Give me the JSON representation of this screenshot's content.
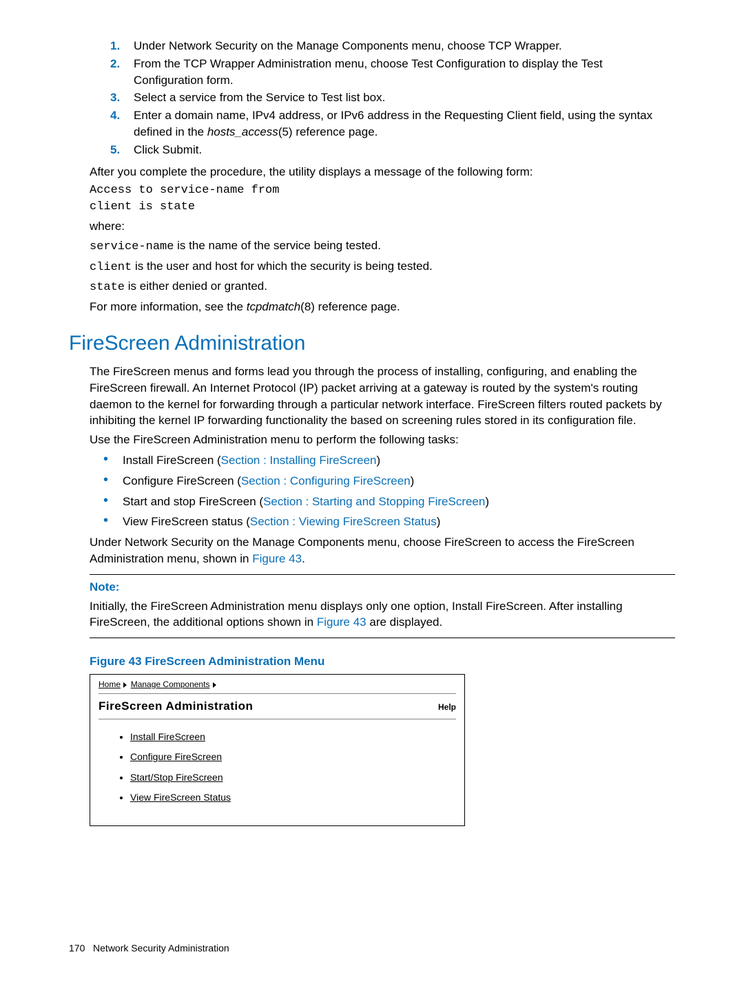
{
  "steps": [
    "Under Network Security on the Manage Components menu, choose TCP Wrapper.",
    "From the TCP Wrapper Administration menu, choose Test Configuration to display the Test Configuration form.",
    "Select a service from the Service to Test list box.",
    "Enter a domain name, IPv4 address, or IPv6 address in the Requesting Client field, using the syntax defined in the |hosts_access|(5) reference page.",
    "Click Submit."
  ],
  "after_proc": "After you complete the procedure, the utility displays a message of the following form:",
  "code_line1": "Access to service-name from",
  "code_line2": "client is state",
  "where_label": "where:",
  "where_l1a": "service-name",
  "where_l1b": " is the name of the service being tested.",
  "where_l2a": "client",
  "where_l2b": " is the user and host for which the security is being tested.",
  "where_l3a": "state",
  "where_l3b": " is either denied or granted.",
  "more_info_a": "For more information, see the ",
  "more_info_i": "tcpdmatch",
  "more_info_b": "(8) reference page.",
  "h2": "FireScreen Administration",
  "fs_para1": "The FireScreen menus and forms lead you through the process of installing, configuring, and enabling the FireScreen firewall. An Internet Protocol (IP) packet arriving at a gateway is routed by the system's routing daemon to the kernel for forwarding through a particular network interface. FireScreen filters routed packets by inhibiting the kernel IP forwarding functionality the based on screening rules stored in its configuration file.",
  "fs_para2": "Use the FireScreen Administration menu to perform the following tasks:",
  "bullets": [
    {
      "txt": "Install FireScreen (",
      "link": "Section : Installing FireScreen",
      "tail": ")"
    },
    {
      "txt": "Configure FireScreen (",
      "link": "Section : Configuring FireScreen",
      "tail": ")"
    },
    {
      "txt": "Start and stop FireScreen (",
      "link": "Section : Starting and Stopping FireScreen",
      "tail": ")"
    },
    {
      "txt": "View FireScreen status (",
      "link": "Section : Viewing FireScreen Status",
      "tail": ")"
    }
  ],
  "under_ns_a": "Under Network Security on the Manage Components menu, choose FireScreen to access the FireScreen Administration menu, shown in ",
  "under_ns_link": "Figure 43",
  "under_ns_b": ".",
  "note_label": "Note:",
  "note_body_a": "Initially, the FireScreen Administration menu displays only one option, Install FireScreen. After installing FireScreen, the additional options shown in ",
  "note_body_link": "Figure 43",
  "note_body_b": " are displayed.",
  "fig_caption": "Figure 43 FireScreen Administration Menu",
  "fig": {
    "bc_home": "Home",
    "bc_mc": "Manage Components",
    "title": "FireScreen Administration",
    "help": "Help",
    "items": [
      "Install FireScreen",
      "Configure FireScreen",
      "Start/Stop FireScreen",
      "View FireScreen Status"
    ]
  },
  "footer_page": "170",
  "footer_title": "Network Security Administration"
}
